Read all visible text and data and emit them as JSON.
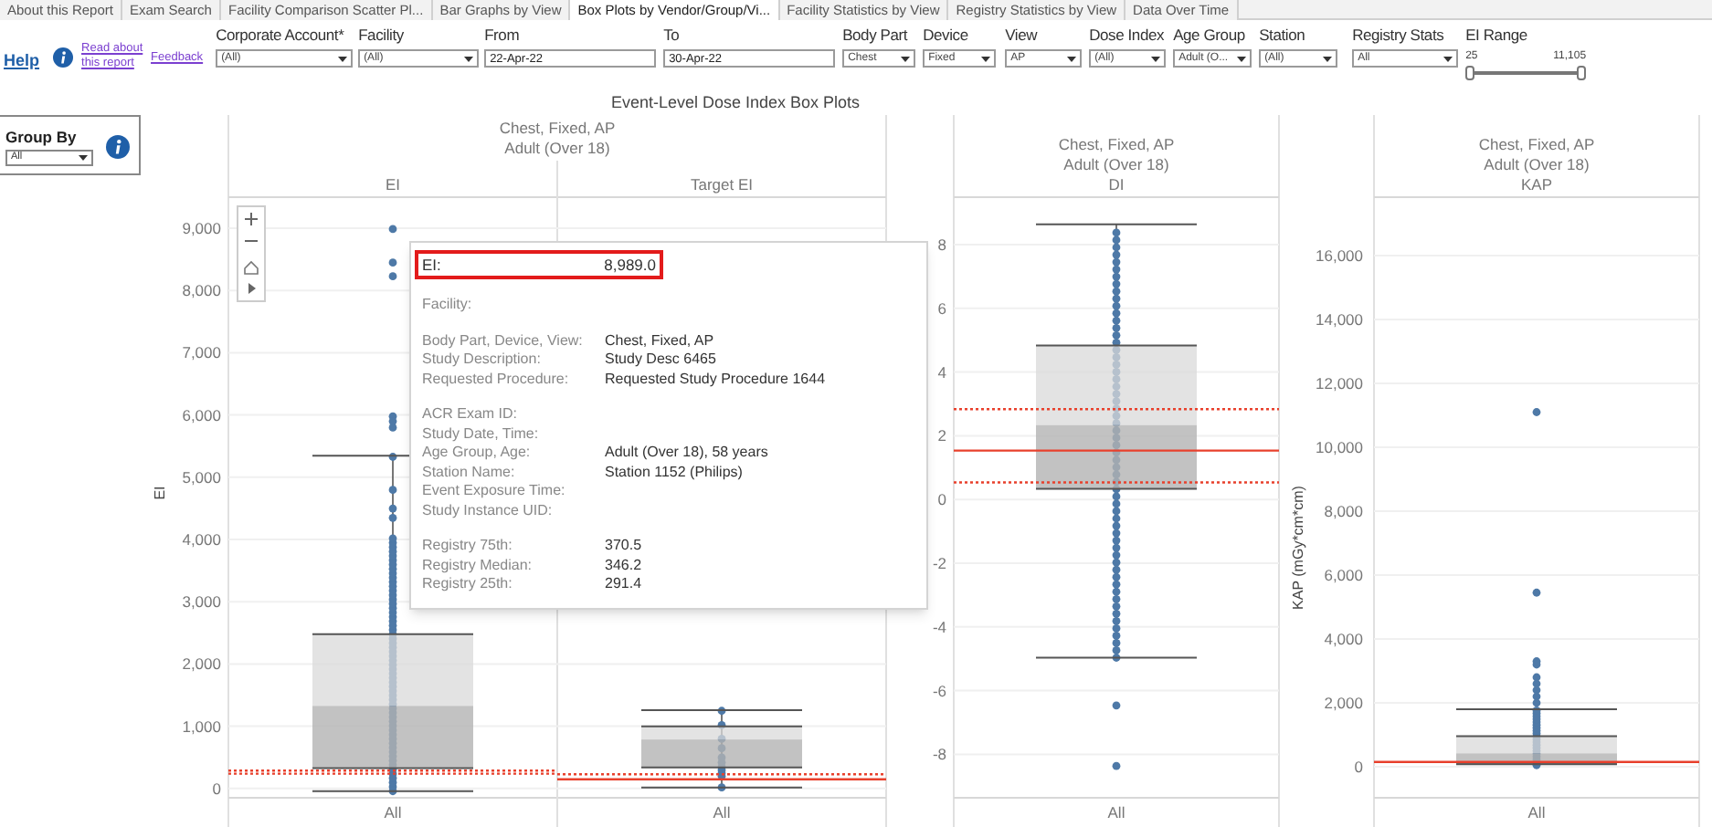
{
  "tabs": [
    {
      "label": "About this Report",
      "selected": false
    },
    {
      "label": "Exam Search",
      "selected": false
    },
    {
      "label": "Facility Comparison Scatter Pl...",
      "selected": false
    },
    {
      "label": "Bar Graphs by View",
      "selected": false
    },
    {
      "label": "Box Plots by Vendor/Group/Vi...",
      "selected": true
    },
    {
      "label": "Facility Statistics by View",
      "selected": false
    },
    {
      "label": "Registry Statistics by View",
      "selected": false
    },
    {
      "label": "Data Over Time",
      "selected": false
    }
  ],
  "toolbar": {
    "help": "Help",
    "about_link": "Read about this report",
    "feedback": "Feedback"
  },
  "filters": [
    {
      "kind": "dropdown",
      "label": "Corporate Account*",
      "value": "(All)"
    },
    {
      "kind": "dropdown",
      "label": "Facility",
      "value": "(All)"
    },
    {
      "kind": "date",
      "label": "From",
      "value": "22-Apr-22"
    },
    {
      "kind": "date",
      "label": "To",
      "value": "30-Apr-22"
    },
    {
      "kind": "dropdown",
      "label": "Body Part",
      "value": "Chest"
    },
    {
      "kind": "dropdown",
      "label": "Device",
      "value": "Fixed"
    },
    {
      "kind": "dropdown",
      "label": "View",
      "value": "AP"
    },
    {
      "kind": "dropdown",
      "label": "Dose Index",
      "value": "(All)"
    },
    {
      "kind": "dropdown",
      "label": "Age Group",
      "value": "Adult (O..."
    },
    {
      "kind": "dropdown",
      "label": "Station",
      "value": "(All)"
    },
    {
      "kind": "dropdown",
      "label": "Registry Stats",
      "value": "All"
    },
    {
      "kind": "range",
      "label": "EI Range",
      "min": "25",
      "max": "11,105",
      "level": 1
    }
  ],
  "title": "Event-Level Dose Index Box Plots",
  "group_by": {
    "label": "Group By",
    "value": "All"
  },
  "panels": [
    {
      "header": [
        "Chest, Fixed, AP",
        "Adult (Over 18)"
      ],
      "axis_title": "EI",
      "columns": [
        {
          "label": "EI",
          "category": "All"
        },
        {
          "label": "Target EI",
          "category": "All"
        }
      ],
      "ticks": [
        "9,000",
        "8,000",
        "7,000",
        "6,000",
        "5,000",
        "4,000",
        "3,000",
        "2,000",
        "1,000",
        "0"
      ]
    },
    {
      "header": [
        "Chest, Fixed, AP",
        "Adult (Over 18)"
      ],
      "columns": [
        {
          "label": "DI",
          "category": "All"
        }
      ],
      "ticks": [
        "8",
        "6",
        "4",
        "2",
        "0",
        "-2",
        "-4",
        "-6",
        "-8"
      ]
    },
    {
      "header": [
        "Chest, Fixed, AP",
        "Adult (Over 18)"
      ],
      "axis_title": "KAP (mGy*cm*cm)",
      "columns": [
        {
          "label": "KAP",
          "category": "All"
        }
      ],
      "ticks": [
        "16,000",
        "14,000",
        "12,000",
        "10,000",
        "8,000",
        "6,000",
        "4,000",
        "2,000",
        "0"
      ]
    }
  ],
  "tooltip": {
    "highlight": {
      "label": "EI:",
      "value": "8,989.0"
    },
    "sections": [
      [
        {
          "label": "Facility:"
        }
      ],
      [
        {
          "label": "Body Part, Device, View:",
          "value": "Chest, Fixed, AP"
        },
        {
          "label": "Study Description:",
          "value": "Study Desc 6465"
        },
        {
          "label": "Requested Procedure:",
          "value": "Requested Study Procedure 1644"
        }
      ],
      [
        {
          "label": "ACR Exam ID:"
        },
        {
          "label": "Study Date, Time:"
        },
        {
          "label": "Age Group, Age:",
          "value": "Adult (Over 18), 58 years"
        },
        {
          "label": "Station Name:",
          "value": "Station 1152 (Philips)"
        },
        {
          "label": "Event Exposure Time:"
        },
        {
          "label": "Study Instance UID:"
        }
      ],
      [
        {
          "label": "Registry 75th:",
          "value": "370.5"
        },
        {
          "label": "Registry Median:",
          "value": "346.2"
        },
        {
          "label": "Registry 25th:",
          "value": "291.4"
        }
      ]
    ]
  }
}
